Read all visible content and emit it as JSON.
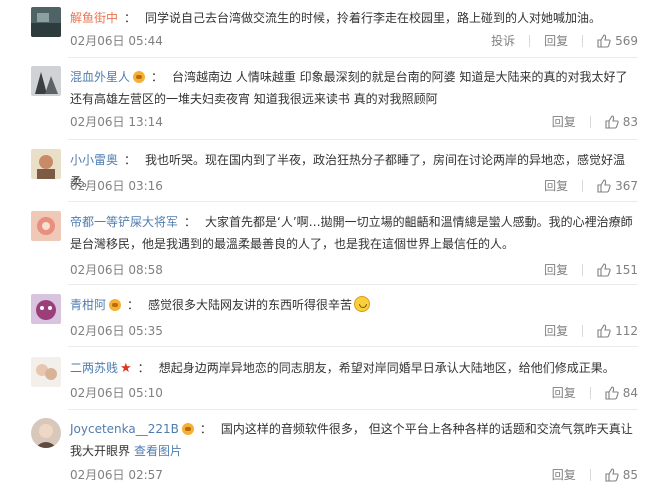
{
  "comments": [
    {
      "username": "解鱼街中",
      "verified": false,
      "text": "同学说自己去台湾做交流生的时候，拎着行李走在校园里，路上碰到的人对她喊加油。",
      "time": "02月06日 05:44",
      "report": "投诉",
      "reply": "回复",
      "likes": "569"
    },
    {
      "username": "混血外星人",
      "verified": true,
      "text": "台湾越南边 人情味越重 印象最深刻的就是台南的阿婆 知道是大陆来的真的对我太好了 还有高雄左营区的一堆夫妇卖夜宵 知道我很远来读书 真的对我照顾阿",
      "time": "02月06日 13:14",
      "reply": "回复",
      "likes": "83"
    },
    {
      "username": "小小雷奥",
      "verified": false,
      "text": "我也听哭。现在国内到了半夜，政治狂热分子都睡了，房间在讨论两岸的异地恋，感觉好温柔。",
      "time": "02月06日 03:16",
      "reply": "回复",
      "likes": "367"
    },
    {
      "username": "帝都一等铲屎大将军",
      "verified": false,
      "text": "大家首先都是‘人’啊…拋開一切立場的齟齬和溫情總是蠻人感動。我的心裡治療師是台灣移民，他是我遇到的最溫柔最善良的人了，也是我在這個世界上最信任的人。",
      "time": "02月06日 08:58",
      "reply": "回复",
      "likes": "151"
    },
    {
      "username": "青柑阿",
      "verified": true,
      "text": "感觉很多大陆网友讲的东西听得很辛苦",
      "time": "02月06日 05:35",
      "reply": "回复",
      "likes": "112"
    },
    {
      "username": "二两苏贱",
      "verified": false,
      "text": "想起身边两岸异地恋的同志朋友，希望对岸同婚早日承认大陆地区，给他们修成正果。",
      "time": "02月06日 05:10",
      "reply": "回复",
      "likes": "84"
    },
    {
      "username": "Joycetenka__221B",
      "verified": true,
      "text": "国内这样的音频软件很多， 但这个平台上各种各样的话题和交流气氛昨天真让我大开眼界",
      "link": "查看图片",
      "time": "02月06日 02:57",
      "reply": "回复",
      "likes": "85"
    }
  ],
  "colors": {
    "username": "#eb7350",
    "link": "#507daf",
    "meta": "#808080",
    "separator": "#ebebeb"
  },
  "icons": {
    "like": "thumbs-up-icon",
    "vip": "crown-badge-icon",
    "star": "star-icon",
    "emoji": "laugh-emoji-icon"
  }
}
